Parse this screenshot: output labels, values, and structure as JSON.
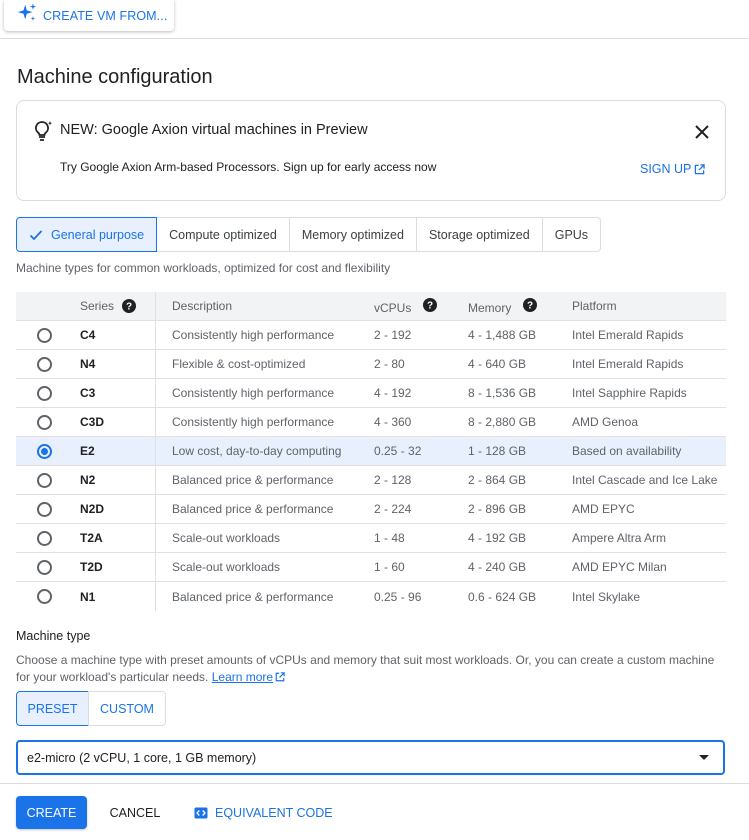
{
  "toolbar": {
    "create_from_label": "CREATE VM FROM..."
  },
  "page_title": "Machine configuration",
  "banner": {
    "title": "NEW: Google Axion virtual machines in Preview",
    "text": "Try Google Axion Arm-based Processors. Sign up for early access now",
    "signup_label": "SIGN UP"
  },
  "tabs": [
    {
      "label": "General purpose",
      "active": true
    },
    {
      "label": "Compute optimized"
    },
    {
      "label": "Memory optimized"
    },
    {
      "label": "Storage optimized"
    },
    {
      "label": "GPUs"
    }
  ],
  "tab_description": "Machine types for common workloads, optimized for cost and flexibility",
  "table": {
    "headers": {
      "series": "Series",
      "description": "Description",
      "vcpus": "vCPUs",
      "memory": "Memory",
      "platform": "Platform"
    },
    "rows": [
      {
        "series": "C4",
        "description": "Consistently high performance",
        "vcpus": "2 - 192",
        "memory": "4 - 1,488 GB",
        "platform": "Intel Emerald Rapids"
      },
      {
        "series": "N4",
        "description": "Flexible & cost-optimized",
        "vcpus": "2 - 80",
        "memory": "4 - 640 GB",
        "platform": "Intel Emerald Rapids"
      },
      {
        "series": "C3",
        "description": "Consistently high performance",
        "vcpus": "4 - 192",
        "memory": "8 - 1,536 GB",
        "platform": "Intel Sapphire Rapids"
      },
      {
        "series": "C3D",
        "description": "Consistently high performance",
        "vcpus": "4 - 360",
        "memory": "8 - 2,880 GB",
        "platform": "AMD Genoa"
      },
      {
        "series": "E2",
        "description": "Low cost, day-to-day computing",
        "vcpus": "0.25 - 32",
        "memory": "1 - 128 GB",
        "platform": "Based on availability",
        "selected": true
      },
      {
        "series": "N2",
        "description": "Balanced price & performance",
        "vcpus": "2 - 128",
        "memory": "2 - 864 GB",
        "platform": "Intel Cascade and Ice Lake"
      },
      {
        "series": "N2D",
        "description": "Balanced price & performance",
        "vcpus": "2 - 224",
        "memory": "2 - 896 GB",
        "platform": "AMD EPYC"
      },
      {
        "series": "T2A",
        "description": "Scale-out workloads",
        "vcpus": "1 - 48",
        "memory": "4 - 192 GB",
        "platform": "Ampere Altra Arm"
      },
      {
        "series": "T2D",
        "description": "Scale-out workloads",
        "vcpus": "1 - 60",
        "memory": "4 - 240 GB",
        "platform": "AMD EPYC Milan"
      },
      {
        "series": "N1",
        "description": "Balanced price & performance",
        "vcpus": "0.25 - 96",
        "memory": "0.6 - 624 GB",
        "platform": "Intel Skylake"
      }
    ]
  },
  "machine_type": {
    "title": "Machine type",
    "description": "Choose a machine type with preset amounts of vCPUs and memory that suit most workloads. Or, you can create a custom machine for your workload's particular needs.",
    "learn_more": "Learn more",
    "preset_label": "PRESET",
    "custom_label": "CUSTOM",
    "selected_value": "e2-micro (2 vCPU, 1 core, 1 GB memory)"
  },
  "footer": {
    "create_label": "CREATE",
    "cancel_label": "CANCEL",
    "code_label": "EQUIVALENT CODE"
  },
  "colors": {
    "accent": "#1a73e8",
    "selected_bg": "#e8f0fe",
    "border": "#dadce0"
  },
  "icons": [
    "sparkle-icon",
    "lightbulb-icon",
    "close-icon",
    "open-in-new-icon",
    "check-icon",
    "help-icon",
    "radio-button",
    "dropdown-caret-icon",
    "code-icon"
  ]
}
